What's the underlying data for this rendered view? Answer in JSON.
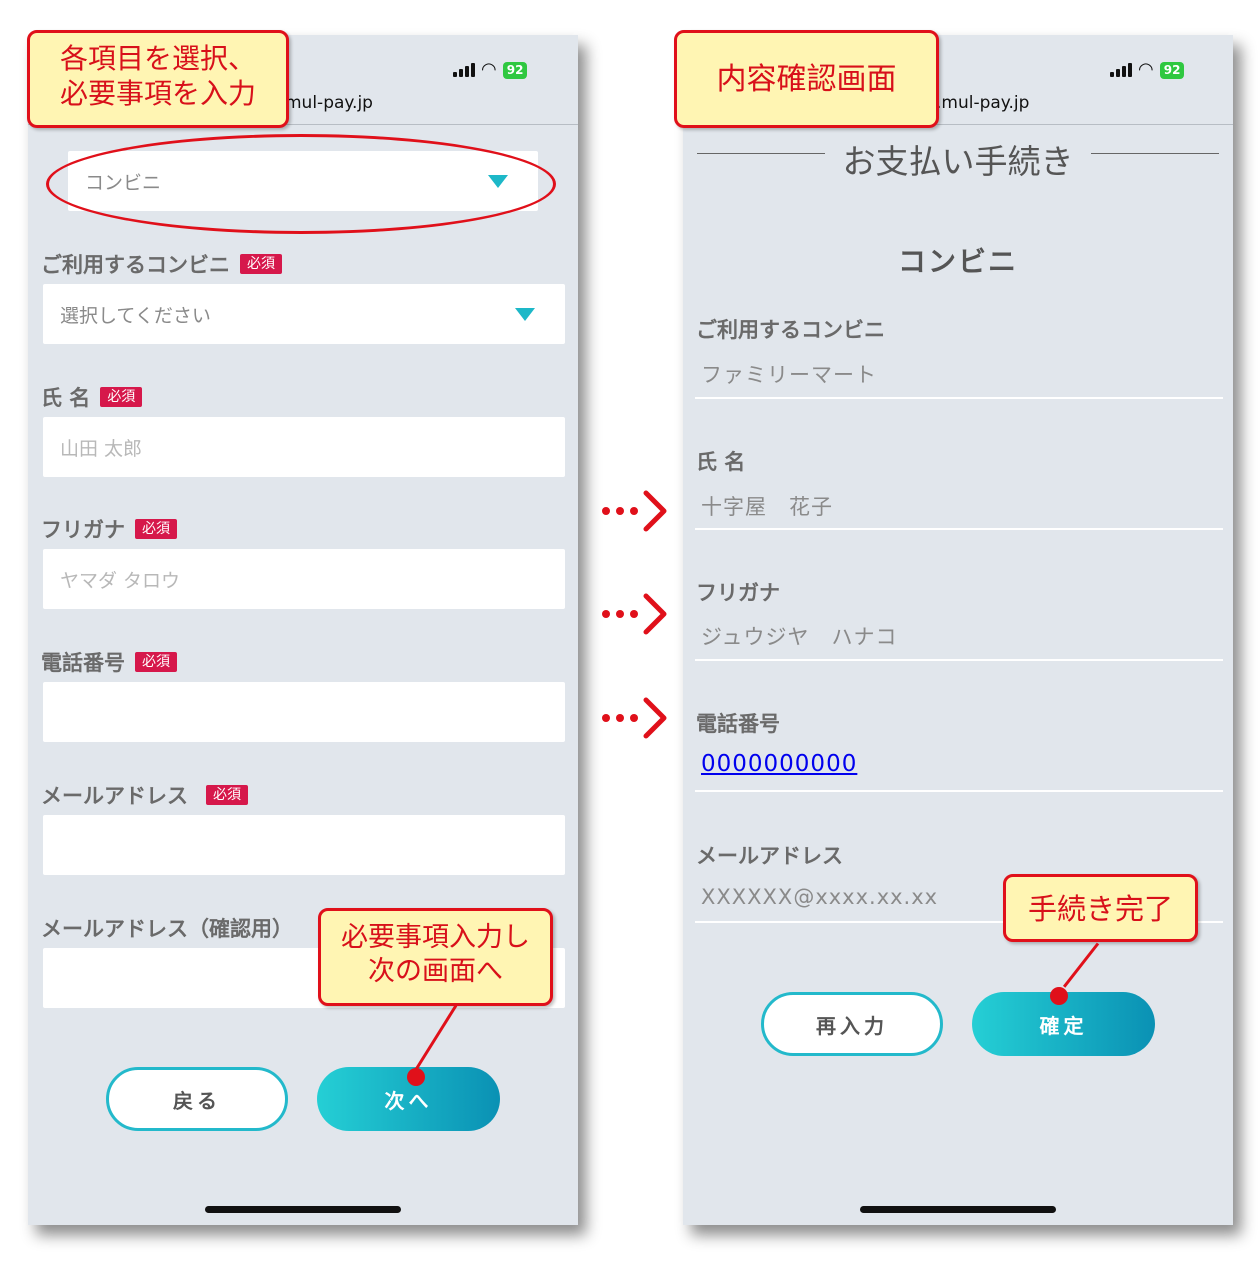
{
  "left": {
    "status": {
      "battery": "92"
    },
    "url_fragment": "mul-pay.jp",
    "payment_method_select": "コンビニ",
    "fields": [
      {
        "label": "ご利用するコンビニ",
        "required": "必須",
        "value": "選択してください",
        "placeholder": ""
      },
      {
        "label": "氏 名",
        "required": "必須",
        "value": "",
        "placeholder": "山田 太郎"
      },
      {
        "label": "フリガナ",
        "required": "必須",
        "value": "",
        "placeholder": "ヤマダ タロウ"
      },
      {
        "label": "電話番号",
        "required": "必須",
        "value": "",
        "placeholder": ""
      },
      {
        "label": "メールアドレス",
        "required": "必須",
        "value": "",
        "placeholder": ""
      },
      {
        "label": "メールアドレス（確認用）",
        "required": "",
        "value": "",
        "placeholder": ""
      }
    ],
    "buttons": {
      "back": "戻る",
      "next": "次へ"
    }
  },
  "right": {
    "status": {
      "battery": "92"
    },
    "url_fragment": ".mul-pay.jp",
    "title": "お支払い手続き",
    "section": "コンビニ",
    "items": [
      {
        "label": "ご利用するコンビニ",
        "value": "ファミリーマート"
      },
      {
        "label": "氏 名",
        "value": "十字屋　花子"
      },
      {
        "label": "フリガナ",
        "value": "ジュウジヤ　ハナコ"
      },
      {
        "label": "電話番号",
        "value": "0000000000"
      },
      {
        "label": "メールアドレス",
        "value": "XXXXXX@xxxx.xx.xx"
      }
    ],
    "buttons": {
      "reenter": "再入力",
      "confirm": "確定"
    }
  },
  "annotations": {
    "select_items": "各項目を選択、\n必要事項を入力",
    "next_screen": "必要事項入力し\n次の画面へ",
    "confirm_screen": "内容確認画面",
    "complete": "手続き完了"
  },
  "colors": {
    "accent": "#23b9cb",
    "required_badge": "#d6184b",
    "annotation_red": "#e0101a",
    "annotation_fill": "#fff5b3",
    "screen_bg": "#e1e6ec"
  }
}
